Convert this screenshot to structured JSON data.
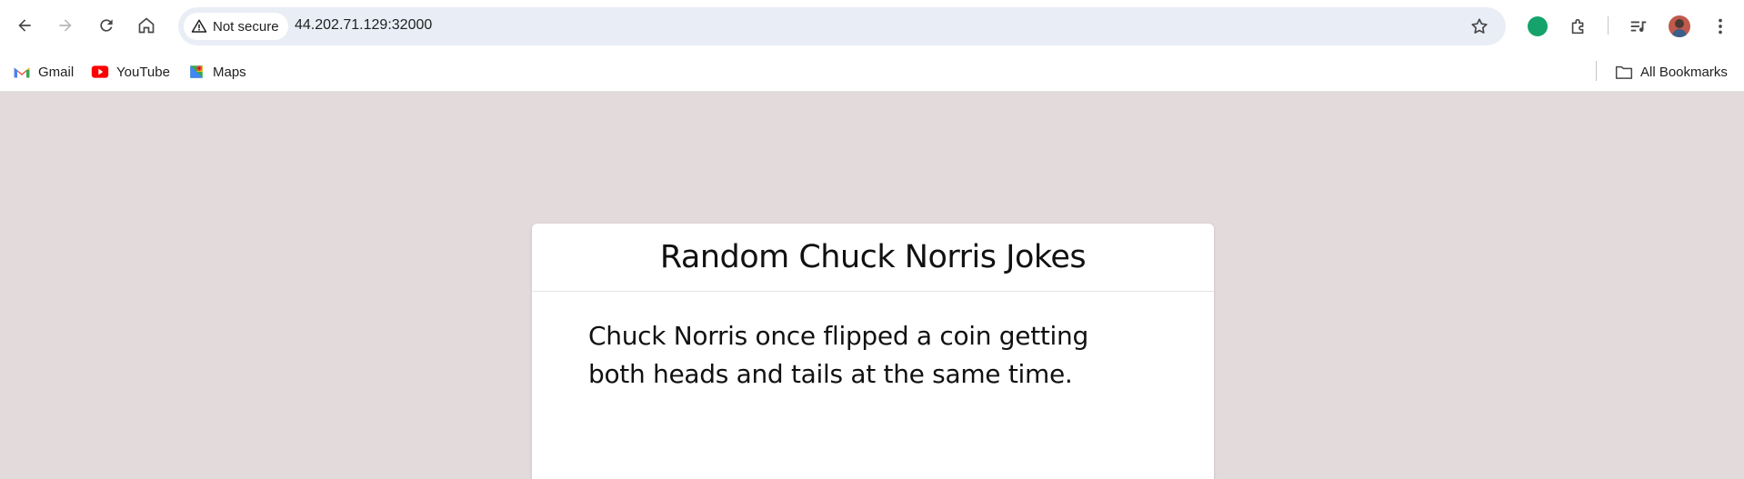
{
  "browser": {
    "security_label": "Not secure",
    "url": "44.202.71.129:32000",
    "icons": [
      "back-icon",
      "forward-icon",
      "reload-icon",
      "home-icon",
      "warning-icon",
      "star-icon",
      "grammarly-icon",
      "extensions-icon",
      "reading-list-icon",
      "profile-avatar",
      "menu-icon"
    ]
  },
  "bookmarks": {
    "items": [
      {
        "label": "Gmail",
        "icon": "gmail-icon"
      },
      {
        "label": "YouTube",
        "icon": "youtube-icon"
      },
      {
        "label": "Maps",
        "icon": "maps-icon"
      }
    ],
    "all_bookmarks_label": "All Bookmarks"
  },
  "page": {
    "title": "Random Chuck Norris Jokes",
    "joke": "Chuck Norris once flipped a coin getting both heads and tails at the same time.",
    "background_color": "#e2dadb"
  }
}
